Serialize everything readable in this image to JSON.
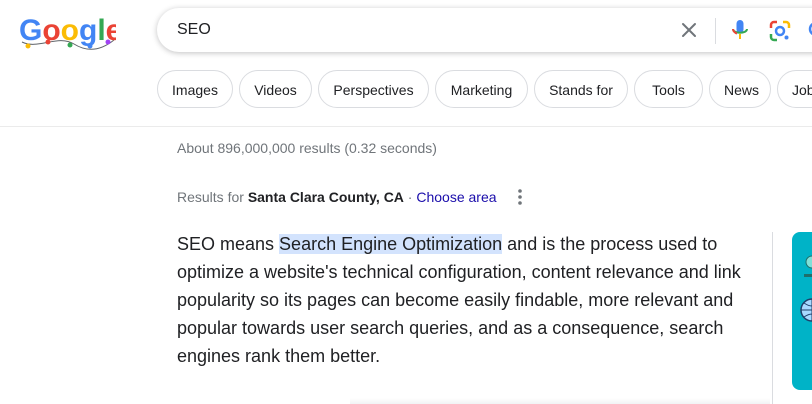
{
  "header": {
    "logo_text": "Google"
  },
  "search": {
    "query": "SEO",
    "clear_icon": "close-icon",
    "mic_icon": "microphone-icon",
    "lens_icon": "lens-icon",
    "submit_icon": "search-icon"
  },
  "chips": [
    "Images",
    "Videos",
    "Perspectives",
    "Marketing",
    "Stands for",
    "Tools",
    "News",
    "Jobs"
  ],
  "results": {
    "stats": "About 896,000,000 results (0.32 seconds)",
    "location_prefix": "Results for ",
    "location_name": "Santa Clara County, CA",
    "location_sep": " · ",
    "choose_area": "Choose area"
  },
  "snippet": {
    "before": "SEO means ",
    "highlight": "Search Engine Optimization",
    "after": " and is the process used to optimize a website's technical configuration, content relevance and link popularity so its pages can become easily findable, more relevant and popular towards user search queries, and as a consequence, search engines rank them better."
  },
  "colors": {
    "link": "#1a0dab",
    "highlight": "#d3e3fd",
    "thumb": "#00b3c7"
  }
}
